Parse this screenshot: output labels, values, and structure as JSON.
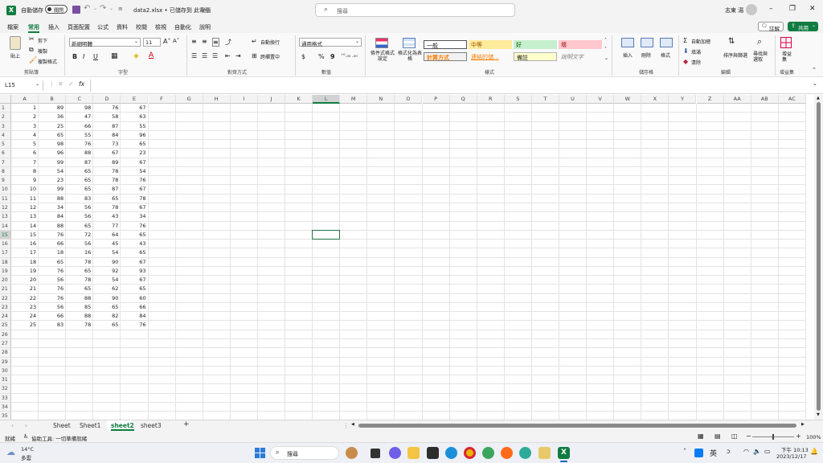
{
  "titlebar": {
    "autosave_label": "自動儲存",
    "autosave_state": "關閉",
    "file_title": "data2.xlsx • 已儲存到 此電腦",
    "search_placeholder": "搜尋",
    "user_name": "志東 湯"
  },
  "menu": {
    "tabs": [
      "檔案",
      "常用",
      "插入",
      "頁面配置",
      "公式",
      "資料",
      "校閱",
      "檢視",
      "自動化",
      "說明"
    ],
    "active_tab": "常用",
    "comments_label": "註解",
    "share_label": "共用"
  },
  "ribbon": {
    "clipboard": {
      "paste": "貼上",
      "cut": "剪下",
      "copy": "複製",
      "format_painter": "複製格式",
      "label": "剪貼簿"
    },
    "font": {
      "name": "新細明體",
      "size": "11",
      "label": "字型"
    },
    "alignment": {
      "wrap": "自動換行",
      "merge": "跨欄置中",
      "label": "對齊方式"
    },
    "number": {
      "format": "通用格式",
      "label": "數值"
    },
    "styles": {
      "conditional": "條件式格式設定",
      "as_table": "格式化為表格",
      "items": [
        {
          "label": "一般",
          "style": "normal"
        },
        {
          "label": "中等",
          "style": "neutral"
        },
        {
          "label": "好",
          "style": "good"
        },
        {
          "label": "壞",
          "style": "bad"
        },
        {
          "label": "計算方式",
          "style": "calc"
        },
        {
          "label": "連結的儲...",
          "style": "linked"
        },
        {
          "label": "備註",
          "style": "note"
        },
        {
          "label": "說明文字",
          "style": "explanatory"
        }
      ],
      "label": "樣式"
    },
    "cells": {
      "insert": "插入",
      "delete": "刪除",
      "format": "格式",
      "label": "儲存格"
    },
    "editing": {
      "autosum": "自動加總",
      "fill": "填滿",
      "clear": "清除",
      "sort": "排序與篩選",
      "find": "尋找與選取",
      "label": "編輯"
    },
    "addins": {
      "addins": "增益集",
      "label": "增益集"
    }
  },
  "formula_bar": {
    "name_box": "L15",
    "fx": "fx",
    "content": ""
  },
  "grid": {
    "columns": [
      "A",
      "B",
      "C",
      "D",
      "E",
      "F",
      "G",
      "H",
      "I",
      "J",
      "K",
      "L",
      "M",
      "N",
      "O",
      "P",
      "Q",
      "R",
      "S",
      "T",
      "U",
      "V",
      "W",
      "X",
      "Y",
      "Z",
      "AA",
      "AB",
      "AC"
    ],
    "row_count": 35,
    "selected_cell": "L15",
    "data": [
      [
        1,
        89,
        98,
        76,
        67
      ],
      [
        2,
        36,
        47,
        58,
        63
      ],
      [
        3,
        25,
        66,
        87,
        55
      ],
      [
        4,
        65,
        55,
        84,
        96
      ],
      [
        5,
        98,
        76,
        73,
        65
      ],
      [
        6,
        96,
        88,
        67,
        23
      ],
      [
        7,
        99,
        87,
        89,
        67
      ],
      [
        8,
        54,
        65,
        78,
        54
      ],
      [
        9,
        23,
        65,
        78,
        76
      ],
      [
        10,
        99,
        65,
        87,
        67
      ],
      [
        11,
        88,
        83,
        65,
        78
      ],
      [
        12,
        34,
        56,
        78,
        67
      ],
      [
        13,
        84,
        56,
        43,
        34
      ],
      [
        14,
        88,
        65,
        77,
        76
      ],
      [
        15,
        76,
        72,
        64,
        65
      ],
      [
        16,
        66,
        56,
        45,
        43
      ],
      [
        17,
        18,
        16,
        54,
        65
      ],
      [
        18,
        65,
        78,
        90,
        67
      ],
      [
        19,
        76,
        65,
        92,
        93
      ],
      [
        20,
        56,
        78,
        54,
        67
      ],
      [
        21,
        76,
        65,
        62,
        65
      ],
      [
        22,
        76,
        88,
        90,
        60
      ],
      [
        23,
        56,
        85,
        65,
        66
      ],
      [
        24,
        66,
        88,
        82,
        84
      ],
      [
        25,
        83,
        78,
        65,
        76
      ]
    ]
  },
  "sheets": {
    "tabs": [
      "Sheet",
      "Sheet1",
      "sheet2",
      "sheet3"
    ],
    "active": "sheet2",
    "add": "+"
  },
  "status": {
    "ready": "就緒",
    "accessibility": "協助工具: 一切準備就緒",
    "zoom": "100%"
  },
  "taskbar": {
    "weather_temp": "14°C",
    "weather_desc": "多雲",
    "search": "搜尋",
    "ime": "英",
    "time": "下午 10:13",
    "date": "2023/12/17"
  },
  "colors": {
    "excel_green": "#107c41",
    "share_green": "#107c41",
    "selection": "#217346"
  }
}
